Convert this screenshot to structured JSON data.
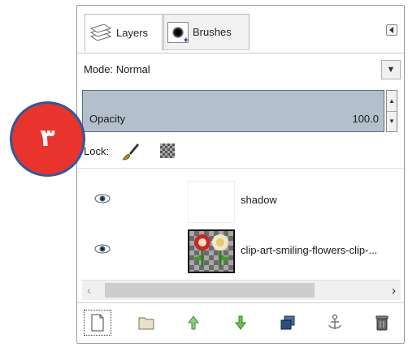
{
  "tabs": [
    {
      "label": "Layers",
      "icon": "layers-icon"
    },
    {
      "label": "Brushes",
      "icon": "brush-icon"
    }
  ],
  "mode": {
    "label": "Mode: Normal"
  },
  "opacity": {
    "label": "Opacity",
    "value": "100.0"
  },
  "lock": {
    "label": "Lock:"
  },
  "layers": [
    {
      "name": "shadow",
      "visible": true
    },
    {
      "name": "clip-art-smiling-flowers-clip-...",
      "visible": true
    }
  ],
  "marker": {
    "text": "۳",
    "color": "#e8342d"
  },
  "toolbar": [
    "new-layer",
    "new-group",
    "raise-layer",
    "lower-layer",
    "duplicate-layer",
    "anchor-layer",
    "delete-layer"
  ]
}
